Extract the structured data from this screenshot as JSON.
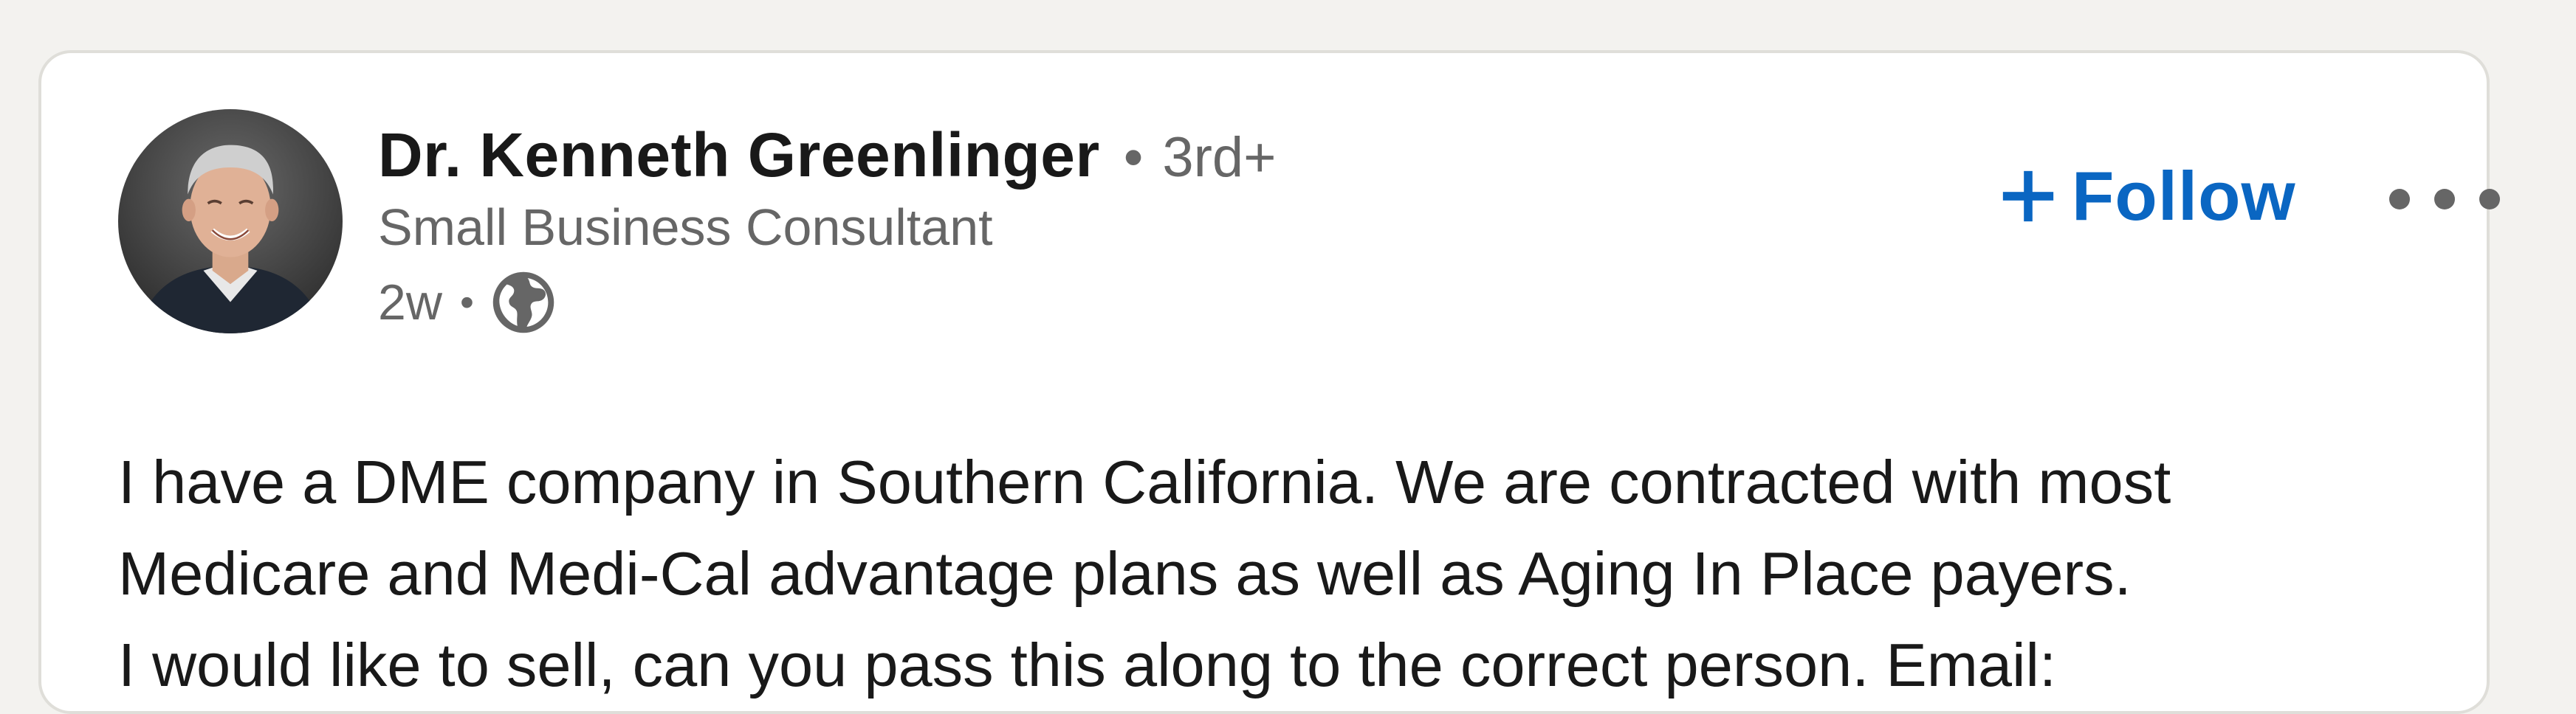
{
  "author": {
    "name": "Dr. Kenneth Greenlinger",
    "separator": "•",
    "degree": "3rd+",
    "headline": "Small Business Consultant",
    "time": "2w",
    "meta_separator": "•",
    "visibility_icon": "globe-icon"
  },
  "actions": {
    "follow_label": "Follow",
    "follow_icon": "plus-icon",
    "more_icon": "more-options-icon"
  },
  "post": {
    "lines": [
      "I have a DME company in Southern California. We are contracted with most",
      "Medicare and Medi-Cal advantage plans as well as Aging In Place payers.",
      "I would like to sell, can you pass this along to the correct person. Email:"
    ]
  },
  "colors": {
    "page_background": "#f3f2ef",
    "card_background": "#ffffff",
    "accent": "#0a66c2",
    "primary_text": "#191919",
    "secondary_text": "#666666"
  }
}
